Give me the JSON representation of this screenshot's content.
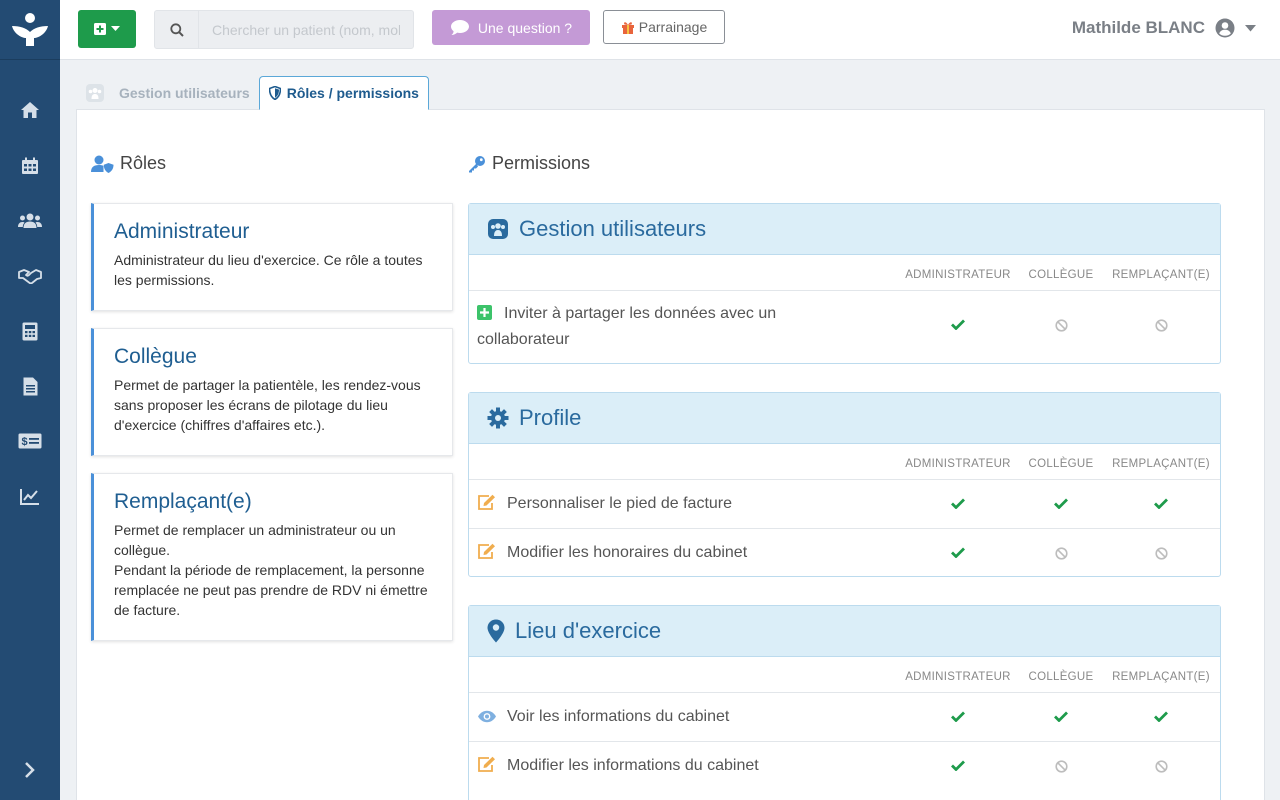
{
  "topbar": {
    "search_placeholder": "Chercher un patient (nom, mobile...)",
    "question_label": "Une question ?",
    "parrainage_label": "Parrainage",
    "user_name": "Mathilde BLANC"
  },
  "tabs": [
    {
      "label": "Gestion utilisateurs",
      "active": false
    },
    {
      "label": "Rôles / permissions",
      "active": true
    }
  ],
  "roles_section": {
    "title": "Rôles",
    "roles": [
      {
        "name": "Administrateur",
        "description": "Administrateur du lieu d'exercice. Ce rôle a toutes les permissions."
      },
      {
        "name": "Collègue",
        "description": "Permet de partager la patientèle, les rendez-vous sans proposer les écrans de pilotage du lieu d'exercice (chiffres d'affaires etc.)."
      },
      {
        "name": "Remplaçant(e)",
        "description": "Permet de remplacer un administrateur ou un collègue.\nPendant la période de remplacement, la personne remplacée ne peut pas prendre de RDV ni émettre de facture."
      }
    ]
  },
  "permissions_section": {
    "title": "Permissions",
    "columns": [
      "ADMINISTRATEUR",
      "COLLÈGUE",
      "REMPLAÇANT(E)"
    ],
    "groups": [
      {
        "title": "Gestion utilisateurs",
        "icon": "users-group-icon",
        "rows": [
          {
            "label": "Inviter à partager les données avec un collaborateur",
            "icon": "plus-square-icon",
            "allowed": [
              true,
              false,
              false
            ]
          }
        ]
      },
      {
        "title": "Profile",
        "icon": "gear-icon",
        "rows": [
          {
            "label": "Personnaliser le pied de facture",
            "icon": "edit-icon",
            "allowed": [
              true,
              true,
              true
            ]
          },
          {
            "label": "Modifier les honoraires du cabinet",
            "icon": "edit-icon",
            "allowed": [
              true,
              false,
              false
            ]
          }
        ]
      },
      {
        "title": "Lieu d'exercice",
        "icon": "map-marker-icon",
        "rows": [
          {
            "label": "Voir les informations du cabinet",
            "icon": "eye-icon",
            "allowed": [
              true,
              true,
              true
            ]
          },
          {
            "label": "Modifier les informations du cabinet",
            "icon": "edit-icon",
            "allowed": [
              true,
              false,
              false
            ]
          }
        ]
      }
    ]
  },
  "colors": {
    "sidebar": "#234b73",
    "accent": "#1e9b4b",
    "question_button": "#c49ad6",
    "role_title": "#1f5e91",
    "group_header": "#dbeef8"
  }
}
